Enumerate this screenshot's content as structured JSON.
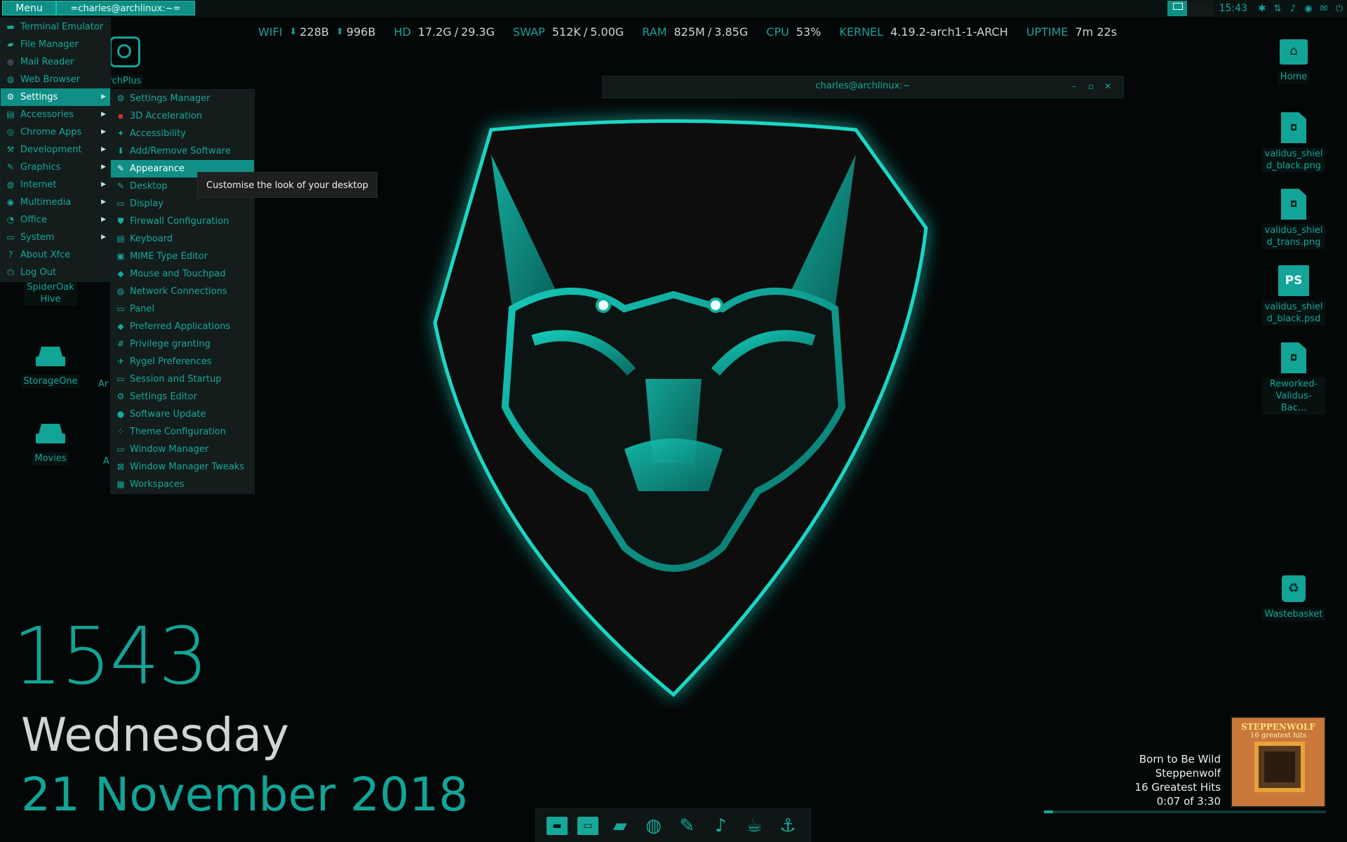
{
  "top_panel": {
    "menu_label": "Menu",
    "task_label": "=charles@archlinux:~=",
    "clock": "15:43",
    "tray_icons": [
      "bluetooth-icon",
      "network-icon",
      "volume-icon",
      "globe-icon",
      "mail-icon",
      "power-icon"
    ]
  },
  "stats": {
    "wifi_label": "WIFI",
    "wifi_down": "228B",
    "wifi_up": "996B",
    "hd_label": "HD",
    "hd_used": "17.2G",
    "hd_total": "29.3G",
    "swap_label": "SWAP",
    "swap_used": "512K",
    "swap_total": "5.00G",
    "ram_label": "RAM",
    "ram_used": "825M",
    "ram_total": "3.85G",
    "cpu_label": "CPU",
    "cpu_val": "53%",
    "kernel_label": "KERNEL",
    "kernel_val": "4.19.2-arch1-1-ARCH",
    "uptime_label": "UPTIME",
    "uptime_val": "7m 22s",
    "separator": "/"
  },
  "main_menu": {
    "items": [
      {
        "label": "Terminal Emulator",
        "icon": "terminal-icon"
      },
      {
        "label": "File Manager",
        "icon": "folder-icon"
      },
      {
        "label": "Mail Reader",
        "icon": "mail-icon"
      },
      {
        "label": "Web Browser",
        "icon": "globe-icon"
      },
      {
        "label": "Settings",
        "icon": "settings-icon"
      },
      {
        "label": "Accessories",
        "icon": "accessories-icon"
      },
      {
        "label": "Chrome Apps",
        "icon": "chrome-icon"
      },
      {
        "label": "Development",
        "icon": "development-icon"
      },
      {
        "label": "Graphics",
        "icon": "graphics-icon"
      },
      {
        "label": "Internet",
        "icon": "internet-icon"
      },
      {
        "label": "Multimedia",
        "icon": "multimedia-icon"
      },
      {
        "label": "Office",
        "icon": "office-icon"
      },
      {
        "label": "System",
        "icon": "system-icon"
      },
      {
        "label": "About Xfce",
        "icon": "help-icon"
      },
      {
        "label": "Log Out",
        "icon": "logout-icon"
      }
    ]
  },
  "settings_menu": {
    "items": [
      {
        "label": "Settings Manager"
      },
      {
        "label": "3D Acceleration"
      },
      {
        "label": "Accessibility"
      },
      {
        "label": "Add/Remove Software"
      },
      {
        "label": "Appearance"
      },
      {
        "label": "Desktop"
      },
      {
        "label": "Display"
      },
      {
        "label": "Firewall Configuration"
      },
      {
        "label": "Keyboard"
      },
      {
        "label": "MIME Type Editor"
      },
      {
        "label": "Mouse and Touchpad"
      },
      {
        "label": "Network Connections"
      },
      {
        "label": "Panel"
      },
      {
        "label": "Preferred Applications"
      },
      {
        "label": "Privilege granting"
      },
      {
        "label": "Rygel Preferences"
      },
      {
        "label": "Session and Startup"
      },
      {
        "label": "Settings Editor"
      },
      {
        "label": "Software Update"
      },
      {
        "label": "Theme Configuration"
      },
      {
        "label": "Window Manager"
      },
      {
        "label": "Window Manager Tweaks"
      },
      {
        "label": "Workspaces"
      }
    ]
  },
  "tooltip": "Customise the look of your desktop",
  "terminal": {
    "title": "charles@archlinux:~"
  },
  "desktop": {
    "left_icons": {
      "archplus": "rchPlus",
      "spideroak": "SpiderOak Hive",
      "storageone": "StorageOne",
      "movies": "Movies",
      "partial1": "Ar",
      "partial2": "A"
    },
    "right_icons": {
      "home": "Home",
      "f1": "validus_shiel d_black.png",
      "f2": "validus_shiel d_trans.png",
      "f3": "validus_shiel d_black.psd",
      "f4": "Reworked- Validus-Bac...",
      "trash": "Wastebasket",
      "ps_text": "PS"
    }
  },
  "clock_widget": {
    "time": "1543",
    "weekday": "Wednesday",
    "date": "21 November 2018"
  },
  "music": {
    "title": "Born to Be Wild",
    "artist": "Steppenwolf",
    "album": "16 Greatest Hits",
    "position": "0:07 of 3:30",
    "progress_fraction": 0.033,
    "cover_band": "STEPPENWOLF",
    "cover_sub": "16 greatest hits"
  },
  "dock": {
    "items": [
      "desktop-icon",
      "terminal-icon",
      "folder-icon",
      "browser-icon",
      "editor-icon",
      "music-icon",
      "teapot-icon",
      "network-manager-icon"
    ]
  },
  "colors": {
    "accent": "#15a99a",
    "panel": "#0b1312",
    "menu_bg": "#141c1c",
    "active": "#0f8f85"
  }
}
